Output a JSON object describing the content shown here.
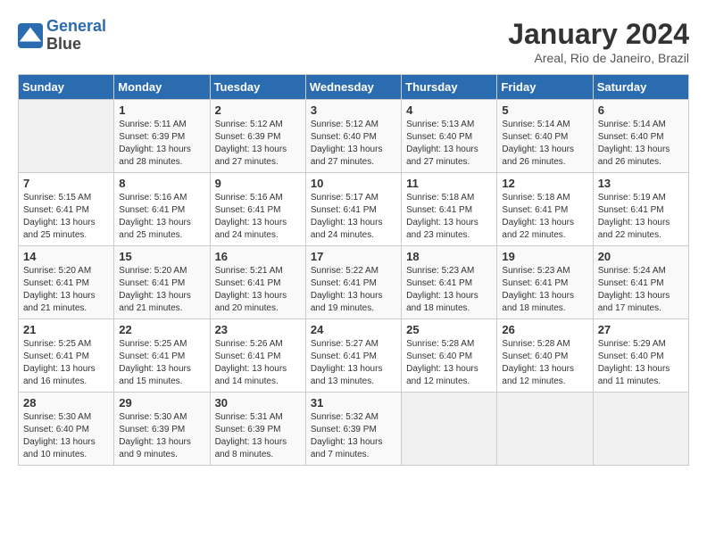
{
  "logo": {
    "line1": "General",
    "line2": "Blue"
  },
  "title": "January 2024",
  "subtitle": "Areal, Rio de Janeiro, Brazil",
  "days_header": [
    "Sunday",
    "Monday",
    "Tuesday",
    "Wednesday",
    "Thursday",
    "Friday",
    "Saturday"
  ],
  "weeks": [
    [
      {
        "day": "",
        "info": ""
      },
      {
        "day": "1",
        "info": "Sunrise: 5:11 AM\nSunset: 6:39 PM\nDaylight: 13 hours\nand 28 minutes."
      },
      {
        "day": "2",
        "info": "Sunrise: 5:12 AM\nSunset: 6:39 PM\nDaylight: 13 hours\nand 27 minutes."
      },
      {
        "day": "3",
        "info": "Sunrise: 5:12 AM\nSunset: 6:40 PM\nDaylight: 13 hours\nand 27 minutes."
      },
      {
        "day": "4",
        "info": "Sunrise: 5:13 AM\nSunset: 6:40 PM\nDaylight: 13 hours\nand 27 minutes."
      },
      {
        "day": "5",
        "info": "Sunrise: 5:14 AM\nSunset: 6:40 PM\nDaylight: 13 hours\nand 26 minutes."
      },
      {
        "day": "6",
        "info": "Sunrise: 5:14 AM\nSunset: 6:40 PM\nDaylight: 13 hours\nand 26 minutes."
      }
    ],
    [
      {
        "day": "7",
        "info": "Sunrise: 5:15 AM\nSunset: 6:41 PM\nDaylight: 13 hours\nand 25 minutes."
      },
      {
        "day": "8",
        "info": "Sunrise: 5:16 AM\nSunset: 6:41 PM\nDaylight: 13 hours\nand 25 minutes."
      },
      {
        "day": "9",
        "info": "Sunrise: 5:16 AM\nSunset: 6:41 PM\nDaylight: 13 hours\nand 24 minutes."
      },
      {
        "day": "10",
        "info": "Sunrise: 5:17 AM\nSunset: 6:41 PM\nDaylight: 13 hours\nand 24 minutes."
      },
      {
        "day": "11",
        "info": "Sunrise: 5:18 AM\nSunset: 6:41 PM\nDaylight: 13 hours\nand 23 minutes."
      },
      {
        "day": "12",
        "info": "Sunrise: 5:18 AM\nSunset: 6:41 PM\nDaylight: 13 hours\nand 22 minutes."
      },
      {
        "day": "13",
        "info": "Sunrise: 5:19 AM\nSunset: 6:41 PM\nDaylight: 13 hours\nand 22 minutes."
      }
    ],
    [
      {
        "day": "14",
        "info": "Sunrise: 5:20 AM\nSunset: 6:41 PM\nDaylight: 13 hours\nand 21 minutes."
      },
      {
        "day": "15",
        "info": "Sunrise: 5:20 AM\nSunset: 6:41 PM\nDaylight: 13 hours\nand 21 minutes."
      },
      {
        "day": "16",
        "info": "Sunrise: 5:21 AM\nSunset: 6:41 PM\nDaylight: 13 hours\nand 20 minutes."
      },
      {
        "day": "17",
        "info": "Sunrise: 5:22 AM\nSunset: 6:41 PM\nDaylight: 13 hours\nand 19 minutes."
      },
      {
        "day": "18",
        "info": "Sunrise: 5:23 AM\nSunset: 6:41 PM\nDaylight: 13 hours\nand 18 minutes."
      },
      {
        "day": "19",
        "info": "Sunrise: 5:23 AM\nSunset: 6:41 PM\nDaylight: 13 hours\nand 18 minutes."
      },
      {
        "day": "20",
        "info": "Sunrise: 5:24 AM\nSunset: 6:41 PM\nDaylight: 13 hours\nand 17 minutes."
      }
    ],
    [
      {
        "day": "21",
        "info": "Sunrise: 5:25 AM\nSunset: 6:41 PM\nDaylight: 13 hours\nand 16 minutes."
      },
      {
        "day": "22",
        "info": "Sunrise: 5:25 AM\nSunset: 6:41 PM\nDaylight: 13 hours\nand 15 minutes."
      },
      {
        "day": "23",
        "info": "Sunrise: 5:26 AM\nSunset: 6:41 PM\nDaylight: 13 hours\nand 14 minutes."
      },
      {
        "day": "24",
        "info": "Sunrise: 5:27 AM\nSunset: 6:41 PM\nDaylight: 13 hours\nand 13 minutes."
      },
      {
        "day": "25",
        "info": "Sunrise: 5:28 AM\nSunset: 6:40 PM\nDaylight: 13 hours\nand 12 minutes."
      },
      {
        "day": "26",
        "info": "Sunrise: 5:28 AM\nSunset: 6:40 PM\nDaylight: 13 hours\nand 12 minutes."
      },
      {
        "day": "27",
        "info": "Sunrise: 5:29 AM\nSunset: 6:40 PM\nDaylight: 13 hours\nand 11 minutes."
      }
    ],
    [
      {
        "day": "28",
        "info": "Sunrise: 5:30 AM\nSunset: 6:40 PM\nDaylight: 13 hours\nand 10 minutes."
      },
      {
        "day": "29",
        "info": "Sunrise: 5:30 AM\nSunset: 6:39 PM\nDaylight: 13 hours\nand 9 minutes."
      },
      {
        "day": "30",
        "info": "Sunrise: 5:31 AM\nSunset: 6:39 PM\nDaylight: 13 hours\nand 8 minutes."
      },
      {
        "day": "31",
        "info": "Sunrise: 5:32 AM\nSunset: 6:39 PM\nDaylight: 13 hours\nand 7 minutes."
      },
      {
        "day": "",
        "info": ""
      },
      {
        "day": "",
        "info": ""
      },
      {
        "day": "",
        "info": ""
      }
    ]
  ]
}
